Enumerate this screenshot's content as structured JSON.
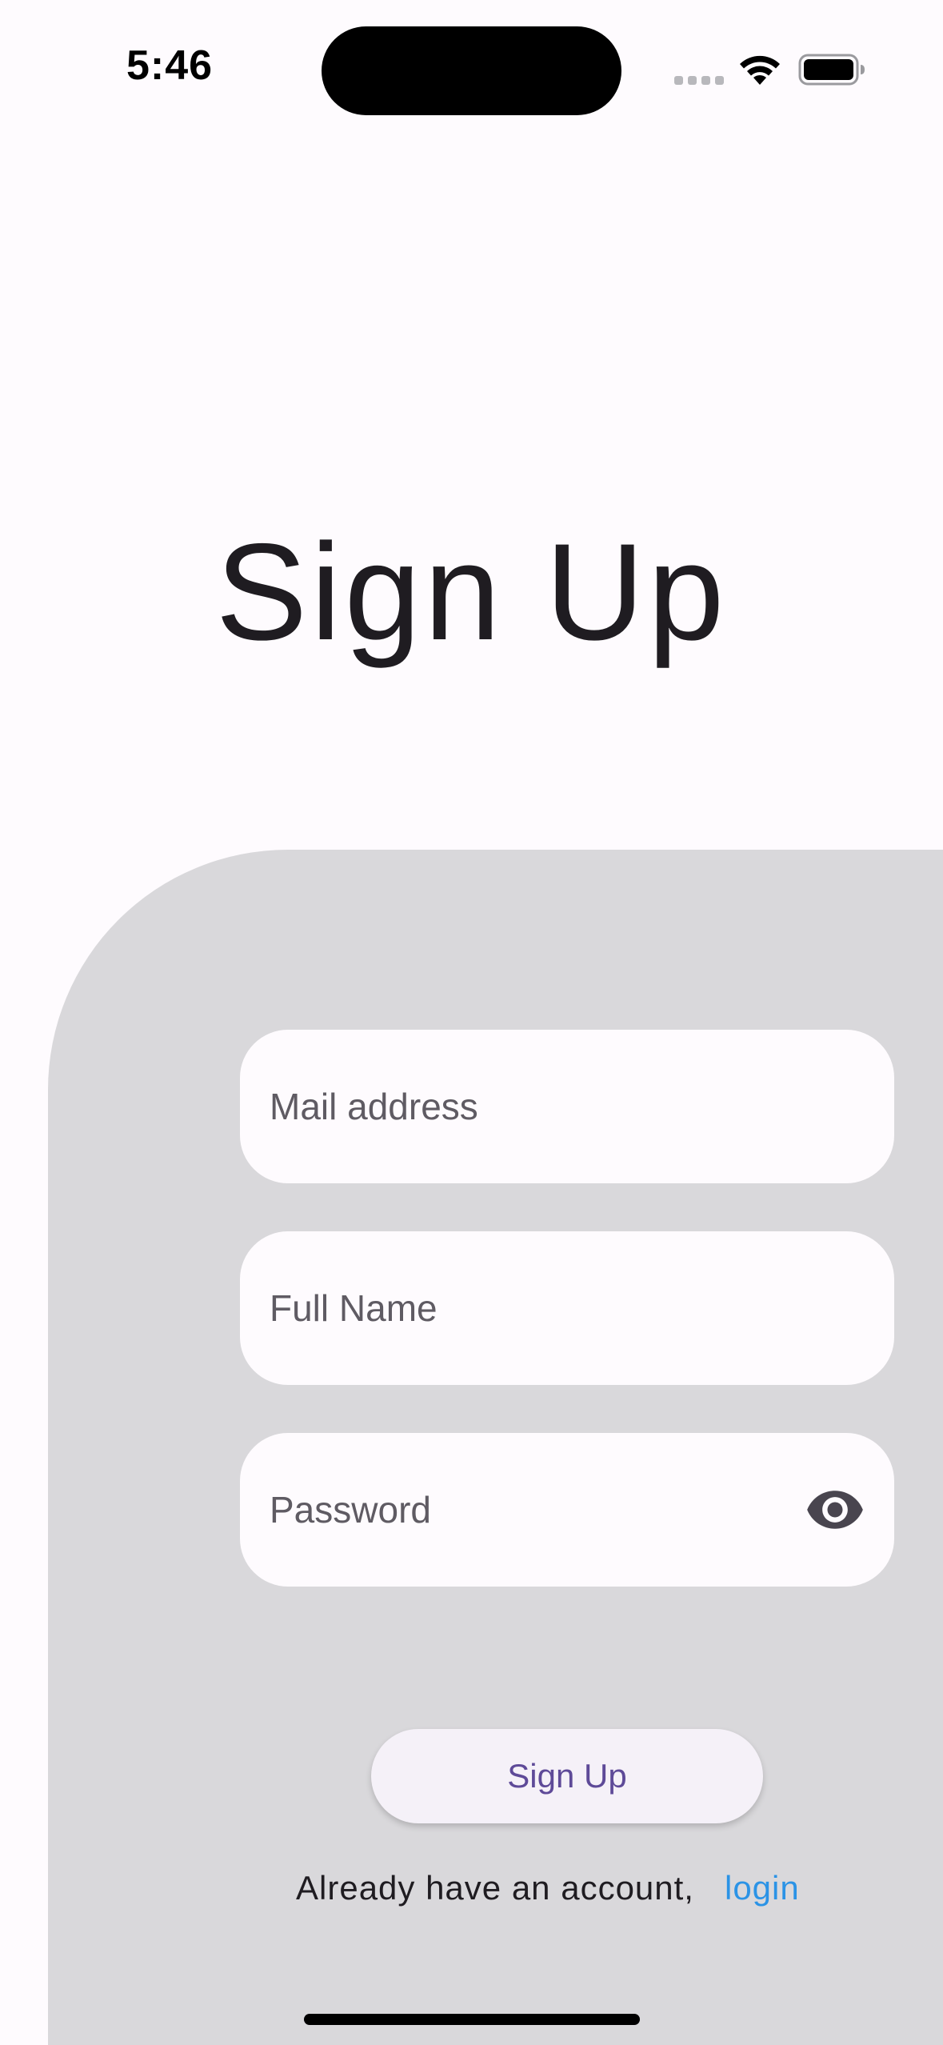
{
  "status_bar": {
    "time": "5:46"
  },
  "title": "Sign Up",
  "form": {
    "email": {
      "placeholder": "Mail address",
      "value": ""
    },
    "full_name": {
      "placeholder": "Full Name",
      "value": ""
    },
    "password": {
      "placeholder": "Password",
      "value": ""
    },
    "submit_label": "Sign Up"
  },
  "footer": {
    "prompt": "Already have an account,",
    "login_label": "login"
  },
  "icons": {
    "wifi": "wifi-icon",
    "battery": "battery-icon",
    "visibility": "eye-icon"
  },
  "colors": {
    "background": "#fefbfe",
    "panel": "#d9d8db",
    "button_text": "#5e4a98",
    "link": "#2b93e6"
  }
}
